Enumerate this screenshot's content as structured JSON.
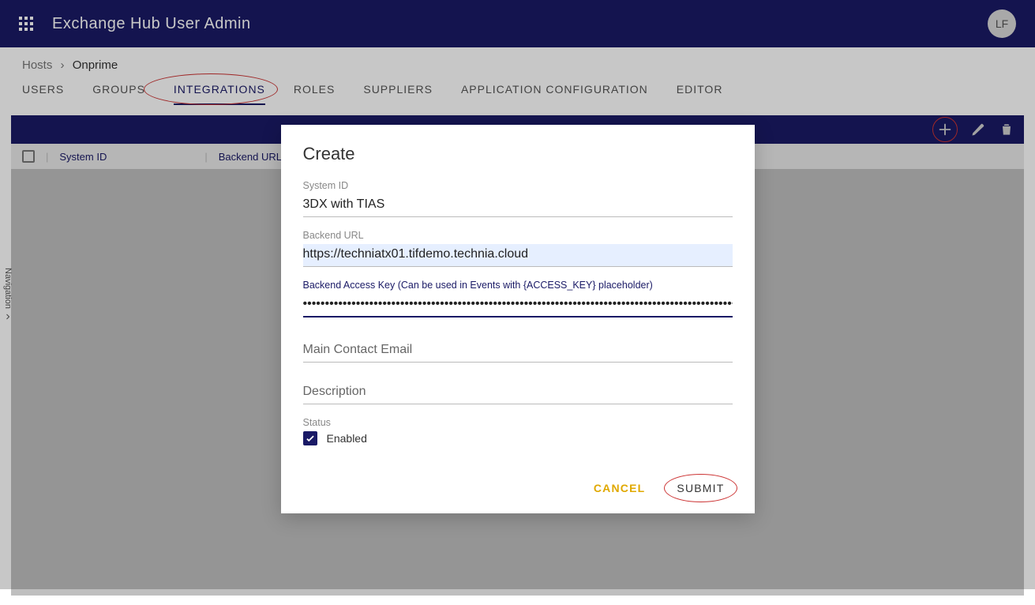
{
  "topbar": {
    "title": "Exchange Hub User Admin",
    "avatar_initials": "LF"
  },
  "breadcrumb": {
    "host": "Hosts",
    "current": "Onprime",
    "separator": "›"
  },
  "tabs": [
    {
      "label": "USERS"
    },
    {
      "label": "GROUPS"
    },
    {
      "label": "INTEGRATIONS",
      "active": true
    },
    {
      "label": "ROLES"
    },
    {
      "label": "SUPPLIERS"
    },
    {
      "label": "APPLICATION CONFIGURATION"
    },
    {
      "label": "EDITOR"
    }
  ],
  "table": {
    "columns": [
      "System ID",
      "Backend URL"
    ]
  },
  "modal": {
    "title": "Create",
    "fields": {
      "system_id": {
        "label": "System ID",
        "value": "3DX with TIAS"
      },
      "backend_url": {
        "label": "Backend URL",
        "value": "https://techniatx01.tifdemo.technia.cloud"
      },
      "access_key": {
        "label": "Backend Access Key (Can be used in Events with {ACCESS_KEY} placeholder)",
        "value": "••••••••••••••••••••••••••••••••••••••••••••••••••••••••••••••••••••••••••••••••••••••••••••••••••••••••••••••••••••••••"
      },
      "contact_email": {
        "placeholder": "Main Contact Email",
        "value": ""
      },
      "description": {
        "placeholder": "Description",
        "value": ""
      },
      "status": {
        "label": "Status",
        "checkbox_label": "Enabled",
        "checked": true
      }
    },
    "actions": {
      "cancel": "CANCEL",
      "submit": "SUBMIT"
    }
  },
  "navrail": {
    "label": "Navigation"
  }
}
